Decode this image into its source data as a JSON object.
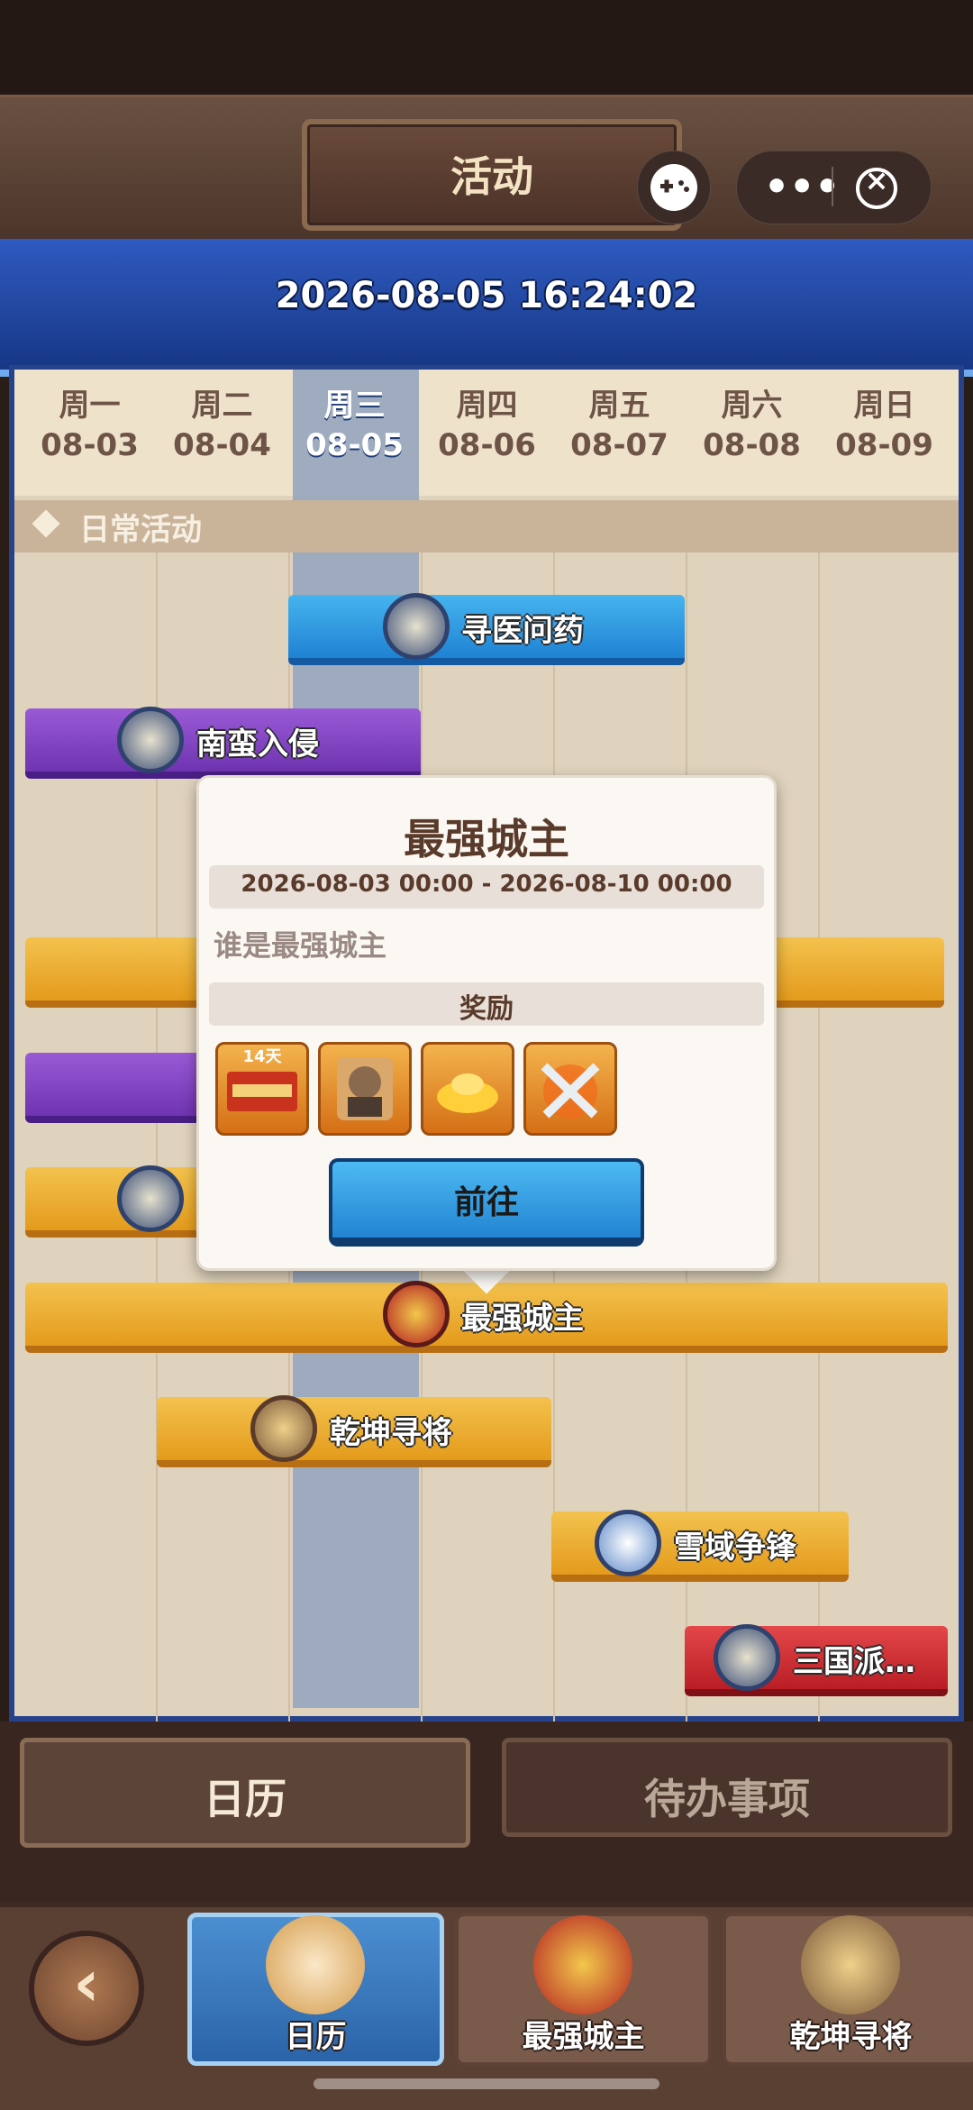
{
  "header": {
    "title": "活动",
    "menu_dots": "•••",
    "datetime": "2026-08-05 16:24:02"
  },
  "calendar": {
    "days": [
      {
        "weekday": "周一",
        "date": "08-03"
      },
      {
        "weekday": "周二",
        "date": "08-04"
      },
      {
        "weekday": "周三",
        "date": "08-05"
      },
      {
        "weekday": "周四",
        "date": "08-06"
      },
      {
        "weekday": "周五",
        "date": "08-07"
      },
      {
        "weekday": "周六",
        "date": "08-08"
      },
      {
        "weekday": "周日",
        "date": "08-09"
      }
    ],
    "section_label": "日常活动",
    "events": [
      {
        "name": "寻医问药",
        "color": "blue"
      },
      {
        "name": "南蛮入侵",
        "color": "purple"
      },
      {
        "name": "最强城主",
        "color": "gold"
      },
      {
        "name": "乾坤寻将",
        "color": "gold"
      },
      {
        "name": "雪域争锋",
        "color": "gold"
      },
      {
        "name": "三国派…",
        "color": "red"
      }
    ]
  },
  "popup": {
    "title": "最强城主",
    "date_range": "2026-08-03 00:00 - 2026-08-10 00:00",
    "description": "谁是最强城主",
    "reward_label": "奖励",
    "rewards": [
      {
        "icon": "title-card-icon",
        "badge": "14天"
      },
      {
        "icon": "general-portrait-icon"
      },
      {
        "icon": "gold-ingot-icon"
      },
      {
        "icon": "crossed-blades-icon"
      }
    ],
    "go_label": "前往"
  },
  "tabs": {
    "calendar": "日历",
    "todo": "待办事项"
  },
  "nav": {
    "items": [
      {
        "label": "日历"
      },
      {
        "label": "最强城主"
      },
      {
        "label": "乾坤寻将"
      }
    ]
  },
  "colors": {
    "header_blue": "#2f5ac0",
    "gold_bar": "#f3c24e",
    "blue_bar": "#1f82d4",
    "purple_bar": "#6f34b1",
    "red_bar": "#b91e25"
  }
}
